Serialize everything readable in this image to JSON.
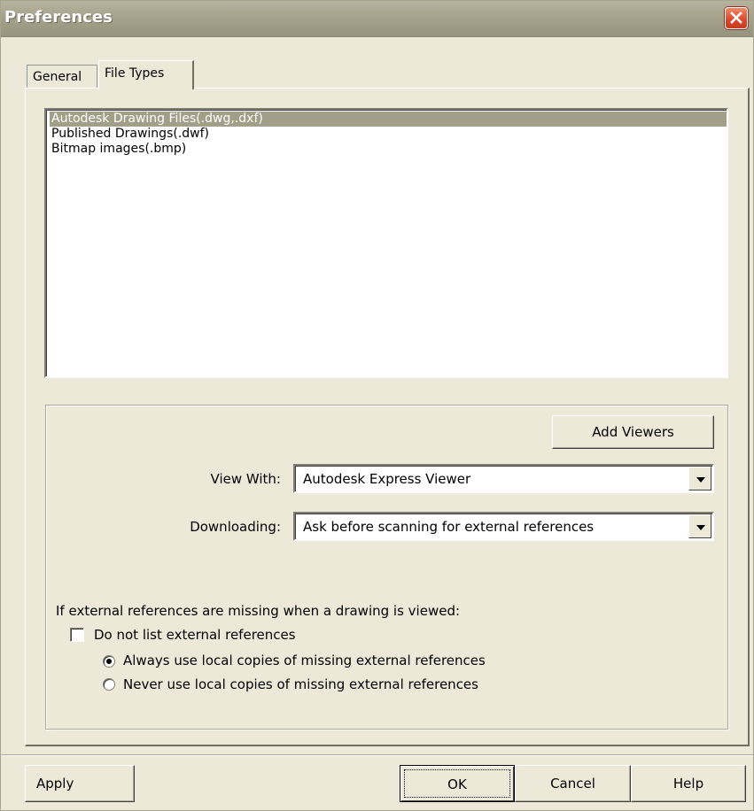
{
  "window": {
    "title": "Preferences"
  },
  "tabs": [
    {
      "label": "General",
      "active": false
    },
    {
      "label": "File Types",
      "active": true
    }
  ],
  "file_types_list": {
    "items": [
      {
        "label": "Autodesk Drawing Files(.dwg,.dxf)",
        "selected": true
      },
      {
        "label": "Published Drawings(.dwf)",
        "selected": false
      },
      {
        "label": "Bitmap images(.bmp)",
        "selected": false
      }
    ]
  },
  "viewer_settings": {
    "add_viewers_label": "Add Viewers",
    "view_with": {
      "label": "View With:",
      "value": "Autodesk Express Viewer"
    },
    "downloading": {
      "label": "Downloading:",
      "value": "Ask before scanning for external references"
    }
  },
  "missing_references": {
    "heading": "If external references are missing when a drawing is viewed:",
    "do_not_list": {
      "label": "Do not list external references",
      "checked": false
    },
    "options": [
      {
        "label": "Always use local copies of missing external references",
        "selected": true
      },
      {
        "label": "Never use local copies of missing external references",
        "selected": false
      }
    ]
  },
  "footer": {
    "apply_label": "Apply",
    "ok_label": "OK",
    "cancel_label": "Cancel",
    "help_label": "Help"
  },
  "colors": {
    "dialog_bg": "#ece9d8",
    "titlebar": "#a6a38d",
    "selection": "#a29f88",
    "close_button": "#d9472a"
  }
}
